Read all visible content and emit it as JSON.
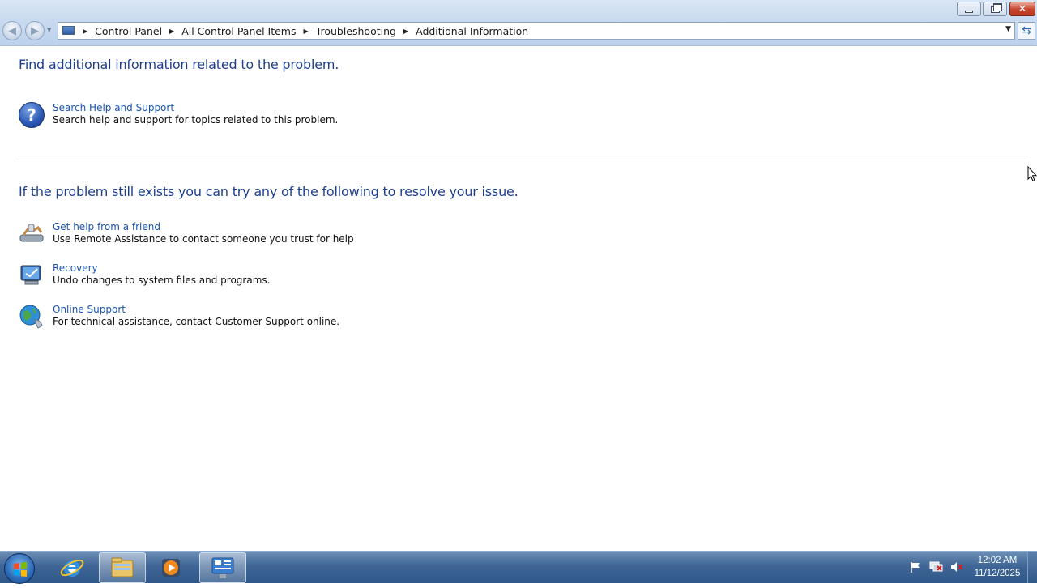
{
  "window": {
    "breadcrumb": [
      "Control Panel",
      "All Control Panel Items",
      "Troubleshooting",
      "Additional Information"
    ],
    "buttons": {
      "minimize": "minimize",
      "maximize": "restore",
      "close": "close"
    }
  },
  "content": {
    "heading_1": "Find additional information related to the problem.",
    "search_help": {
      "link": "Search Help and Support",
      "description": "Search help and support for topics related to this problem."
    },
    "heading_2": "If the problem still exists you can try any of the following to resolve your issue.",
    "options": [
      {
        "link": "Get help from a friend",
        "description": "Use Remote Assistance to contact someone you trust for help",
        "icon": "remote-assistance-icon"
      },
      {
        "link": "Recovery",
        "description": "Undo changes to system files and programs.",
        "icon": "recovery-icon"
      },
      {
        "link": "Online Support",
        "description": "For technical assistance, contact Customer Support online.",
        "icon": "globe-support-icon"
      }
    ]
  },
  "taskbar": {
    "clock_time": "12:02 AM",
    "clock_date": "11/12/2025",
    "pinned": [
      "internet-explorer-icon",
      "windows-explorer-icon",
      "media-player-icon",
      "control-panel-icon"
    ],
    "tray": [
      "action-center-flag-icon",
      "network-icon",
      "volume-muted-icon"
    ]
  },
  "colors": {
    "heading": "#1e3f8c",
    "link": "#1a55b3",
    "taskbar": "#3f6696"
  }
}
